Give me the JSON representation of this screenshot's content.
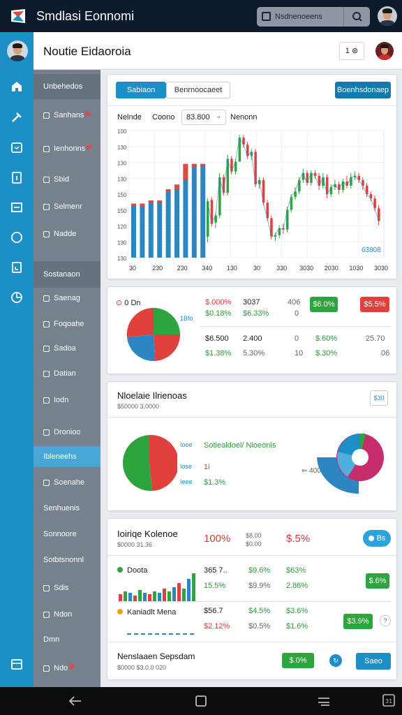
{
  "app": {
    "title": "Smdlasi Eonnomi"
  },
  "search": {
    "placeholder": "Nsdnenoeens"
  },
  "header": {
    "title": "Noutie Eidaoroia",
    "notif_label": "1 ⊚"
  },
  "sidebar": {
    "section1_title": "Unbehedos",
    "items": [
      {
        "label": "Sanhans",
        "badge": true
      },
      {
        "label": "Ienhonns",
        "badge": true
      },
      {
        "label": "Sbid"
      },
      {
        "label": "Selmenr"
      },
      {
        "label": "Nadde"
      }
    ],
    "section2_title": "Sostanaon",
    "items2": [
      {
        "label": "Saenag"
      },
      {
        "label": "Foqoahe"
      },
      {
        "label": "Sadoa"
      },
      {
        "label": "Datian"
      },
      {
        "label": "Iodn"
      },
      {
        "label": "Dronioo"
      },
      {
        "label": "Ibleneehs",
        "active": true
      },
      {
        "label": "Soenahe"
      },
      {
        "label": "Senhuenis"
      },
      {
        "label": "Sonnoore"
      },
      {
        "label": "Sotbtsnonnl"
      },
      {
        "label": "Sdis"
      },
      {
        "label": "Ndon"
      },
      {
        "label": "Dmn"
      },
      {
        "label": "Ndo"
      }
    ]
  },
  "market": {
    "tab_active": "Sabiaon",
    "tab_inactive": "Benrnoocaeet",
    "action_button": "Boenhsdonaep",
    "filter_a": "Nelnde",
    "filter_b": "Coono",
    "select_value": "83.800",
    "filter_c": "Nenonn",
    "badge": "63808"
  },
  "chart_data": {
    "type": "bar+candlestick",
    "y_ticks": [
      "100",
      "130",
      "130",
      "130",
      "150",
      "150",
      "120",
      "130",
      "130"
    ],
    "x_ticks": [
      "30",
      "230",
      "230",
      "340",
      "130",
      "30",
      "330",
      "3030",
      "2030",
      "1030",
      "3030"
    ],
    "bars": [
      {
        "x": 0,
        "value": 68,
        "top": 6
      },
      {
        "x": 1,
        "value": 68,
        "top": 6
      },
      {
        "x": 2,
        "value": 72,
        "top": 6
      },
      {
        "x": 3,
        "value": 72,
        "top": 6
      },
      {
        "x": 4,
        "value": 86,
        "top": 6
      },
      {
        "x": 5,
        "value": 92,
        "top": 12
      },
      {
        "x": 6,
        "value": 118,
        "top": 40
      },
      {
        "x": 7,
        "value": 118,
        "top": 8
      },
      {
        "x": 8,
        "value": 118,
        "top": 6
      }
    ],
    "candles": [
      [
        150,
        100,
        158,
        96
      ],
      [
        98,
        132,
        136,
        94
      ],
      [
        130,
        120,
        138,
        116
      ],
      [
        120,
        66,
        124,
        60
      ],
      [
        66,
        88,
        92,
        62
      ],
      [
        88,
        40,
        92,
        34
      ],
      [
        40,
        58,
        62,
        36
      ],
      [
        58,
        44,
        62,
        40
      ],
      [
        44,
        10,
        14,
        6
      ],
      [
        10,
        20,
        24,
        6
      ],
      [
        20,
        36,
        40,
        16
      ],
      [
        36,
        30,
        42,
        26
      ],
      [
        30,
        76,
        80,
        26
      ],
      [
        76,
        70,
        82,
        66
      ],
      [
        70,
        102,
        106,
        66
      ],
      [
        102,
        124,
        128,
        98
      ],
      [
        124,
        150,
        154,
        120
      ],
      [
        150,
        148,
        156,
        144
      ],
      [
        148,
        138,
        152,
        134
      ],
      [
        138,
        140,
        146,
        132
      ],
      [
        140,
        112,
        144,
        108
      ],
      [
        112,
        94,
        116,
        90
      ],
      [
        94,
        86,
        98,
        80
      ],
      [
        86,
        70,
        90,
        66
      ],
      [
        70,
        60,
        74,
        54
      ],
      [
        60,
        74,
        78,
        56
      ],
      [
        74,
        60,
        78,
        56
      ],
      [
        60,
        64,
        68,
        56
      ],
      [
        64,
        78,
        84,
        60
      ],
      [
        78,
        66,
        82,
        60
      ],
      [
        66,
        90,
        96,
        62
      ],
      [
        90,
        80,
        94,
        76
      ],
      [
        80,
        76,
        84,
        70
      ],
      [
        76,
        84,
        90,
        72
      ],
      [
        84,
        72,
        88,
        68
      ],
      [
        72,
        78,
        82,
        64
      ],
      [
        78,
        66,
        82,
        60
      ],
      [
        66,
        64,
        70,
        58
      ],
      [
        64,
        70,
        74,
        60
      ],
      [
        70,
        78,
        84,
        66
      ],
      [
        78,
        90,
        94,
        74
      ],
      [
        90,
        96,
        100,
        86
      ],
      [
        96,
        110,
        114,
        92
      ],
      [
        110,
        128,
        134,
        106
      ]
    ]
  },
  "summary": {
    "pie_label": "0 Dn",
    "pie_side_label": "1Bfo",
    "r1c1": "$.000%",
    "r1c2": "$0.18%",
    "r1c3": "3037",
    "r1c4": "$6.33%",
    "r1c5": "406",
    "r1c6": "0",
    "r1_green": "$6.0%",
    "r1_red": "$5.5%",
    "r2c1": "$6.500",
    "r2c2": "$1.38%",
    "r2c3": "2.400",
    "r2c4": "5.30%",
    "r2c5": "0",
    "r2c6": "10",
    "r2c7": "$.60%",
    "r2c8": "$.30%",
    "r2c9": "25.70",
    "r2c10": "06"
  },
  "allocation": {
    "title": "Nloelaie Ilrienoas",
    "subtitle": "$50000 3.0000",
    "corner_btn": "$30",
    "pie_lbl_1": "Iooe",
    "pie_lbl_2": "Iose",
    "pie_lbl_3": "Ieee",
    "legend_title": "Sotiealdoel/ Nloeonis",
    "legend_val": "1i",
    "legend_pct": "$1.3%",
    "arrow_label": "400"
  },
  "holdings": {
    "title": "Ioiriqe Kolenoe",
    "subtitle": "$0000 31.36",
    "pct_main": "100%",
    "pct_gray": "$8.00 $0.00",
    "pct_red": "$.5%",
    "pill": "Bs",
    "row1_label": "Doota",
    "row1_v1": "365 7..",
    "row1_v2": "$9.6%",
    "row1_v3": "$63%",
    "row1_v4": "15.5%",
    "row1_v5": "$9.9%",
    "row1_v6": "2.86%",
    "row1_btn": "$.6%",
    "row2_label": "Kaniadlt Mena",
    "row2_v1": "$56.7",
    "row2_v2": "$4.5%",
    "row2_v3": "$3.6%",
    "row2_v4": "$2.12%",
    "row2_v5": "$0.5%",
    "row2_v6": "$1.6%",
    "row2_btn": "$3.9%",
    "footer_title": "Nenslaaen Sepsdam",
    "footer_sub": "$0000 $3.0.0 020",
    "footer_green": "$.0%",
    "footer_blue": "Saeo"
  },
  "colors": {
    "accent": "#1d8fc7",
    "positive": "#2ea43f",
    "negative": "#e0413c",
    "bar_blue": "#2d86c4",
    "bar_red": "#e04b3f"
  }
}
